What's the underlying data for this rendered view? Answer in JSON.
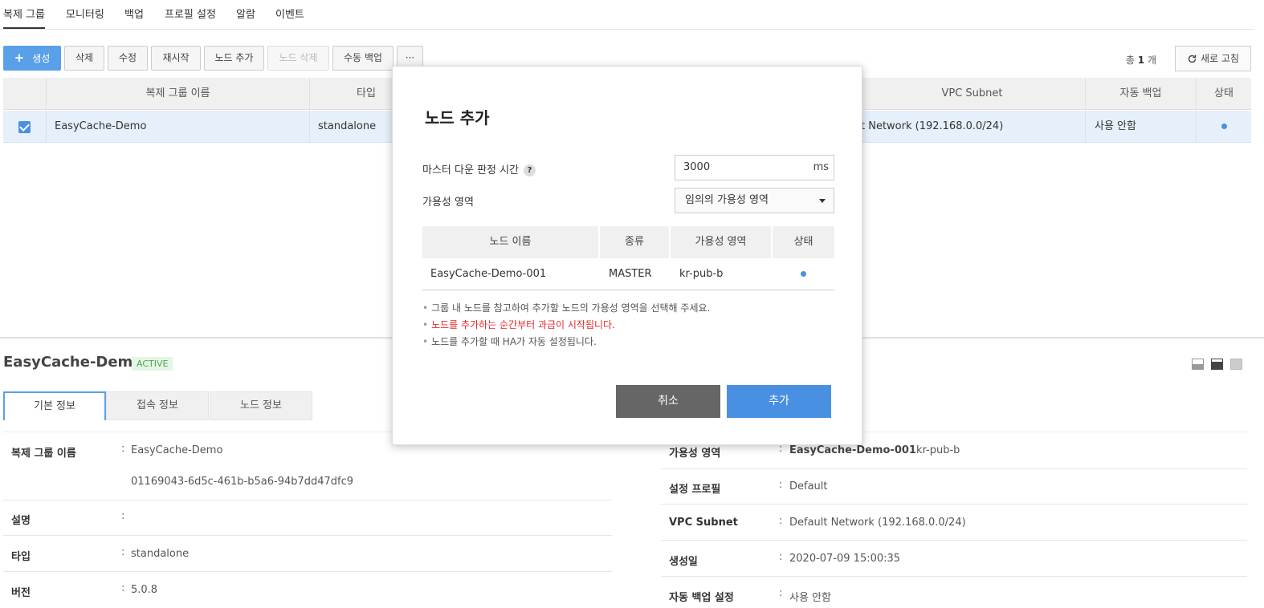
{
  "nav": {
    "tabs": [
      "복제 그룹",
      "모니터링",
      "백업",
      "프로필 설정",
      "알람",
      "이벤트"
    ]
  },
  "toolbar": {
    "create": "생성",
    "delete": "삭제",
    "edit": "수정",
    "restart": "재시작",
    "add_node": "노드 추가",
    "delete_node": "노드 삭제",
    "manual_backup": "수동 백업",
    "more": "···",
    "total_prefix": "총",
    "total_count": "1",
    "total_suffix": "개",
    "refresh": "새로 고침"
  },
  "grid": {
    "headers": {
      "name": "복제 그룹 이름",
      "type": "타입",
      "vpc": "VPC Subnet",
      "auto_backup": "자동 백업",
      "status": "상태"
    },
    "row": {
      "name": "EasyCache-Demo",
      "type": "standalone",
      "vpc": "t Network (192.168.0.0/24)",
      "auto_backup": "사용 안함"
    }
  },
  "detail": {
    "title": "EasyCache-Demo",
    "badge": "ACTIVE",
    "tabs": [
      "기본 정보",
      "접속 정보",
      "노드 정보"
    ],
    "left": {
      "name_label": "복제 그룹 이름",
      "name_value": "EasyCache-Demo",
      "id_value": "01169043-6d5c-461b-b5a6-94b7dd47dfc9",
      "desc_label": "설명",
      "desc_value": "",
      "type_label": "타입",
      "type_value": "standalone",
      "version_label": "버전",
      "version_value": "5.0.8"
    },
    "right": {
      "az_label": "가용성 영역",
      "az_node": "EasyCache-Demo-001",
      "az_value": "kr-pub-b",
      "profile_label": "설정 프로필",
      "profile_value": "Default",
      "vpc_label": "VPC Subnet",
      "vpc_value": "Default Network (192.168.0.0/24)",
      "created_label": "생성일",
      "created_value": "2020-07-09 15:00:35",
      "backup_label": "자동 백업 설정",
      "backup_value": "사용 안함"
    },
    "colon": ":"
  },
  "modal": {
    "title": "노드 추가",
    "master_down_label": "마스터 다운 판정 시간",
    "master_down_value": "3000",
    "master_down_unit": "ms",
    "help": "?",
    "az_label": "가용성 영역",
    "az_selected": "임의의 가용성 영역",
    "table": {
      "headers": [
        "노드 이름",
        "종류",
        "가용성 영역",
        "상태"
      ],
      "row": {
        "name": "EasyCache-Demo-001",
        "kind": "MASTER",
        "az": "kr-pub-b"
      }
    },
    "notes": [
      "그룹 내 노드를 참고하여 추가할 노드의 가용성 영역을 선택해 주세요.",
      "노드를 추가하는 순간부터 과금이 시작됩니다.",
      "노드를 추가할 때 HA가 자동 설정됩니다."
    ],
    "cancel": "취소",
    "confirm": "추가"
  },
  "colors": {
    "accent": "#4a90e2",
    "warning": "#e02a2a",
    "active_badge": "#4aa84a"
  }
}
